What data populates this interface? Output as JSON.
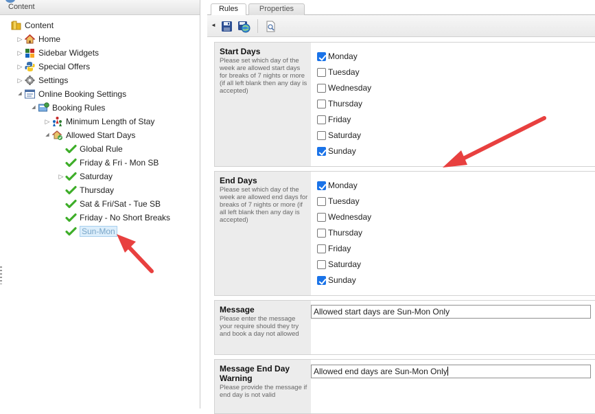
{
  "left_panel": {
    "header": "Content",
    "tree": [
      {
        "label": "Content",
        "icon": "folder-icon",
        "level": 0,
        "expander": "none"
      },
      {
        "label": "Home",
        "icon": "home-icon",
        "level": 1,
        "expander": "collapsed"
      },
      {
        "label": "Sidebar Widgets",
        "icon": "widgets-icon",
        "level": 1,
        "expander": "collapsed"
      },
      {
        "label": "Special Offers",
        "icon": "python-icon",
        "level": 1,
        "expander": "collapsed"
      },
      {
        "label": "Settings",
        "icon": "gear-icon",
        "level": 1,
        "expander": "collapsed"
      },
      {
        "label": "Online Booking Settings",
        "icon": "settings-form-icon",
        "level": 1,
        "expander": "expanded"
      },
      {
        "label": "Booking Rules",
        "icon": "rules-icon",
        "level": 2,
        "expander": "expanded"
      },
      {
        "label": "Minimum Length of Stay",
        "icon": "people-icon",
        "level": 3,
        "expander": "collapsed"
      },
      {
        "label": "Allowed Start Days",
        "icon": "house-check-icon",
        "level": 3,
        "expander": "expanded"
      },
      {
        "label": "Global Rule",
        "icon": "checkmark-icon",
        "level": 4,
        "expander": "none"
      },
      {
        "label": "Friday & Fri - Mon SB",
        "icon": "checkmark-icon",
        "level": 4,
        "expander": "none"
      },
      {
        "label": "Saturday",
        "icon": "checkmark-icon",
        "level": 4,
        "expander": "collapsed"
      },
      {
        "label": "Thursday",
        "icon": "checkmark-icon",
        "level": 4,
        "expander": "none"
      },
      {
        "label": "Sat & Fri/Sat - Tue SB",
        "icon": "checkmark-icon",
        "level": 4,
        "expander": "none"
      },
      {
        "label": "Friday - No Short Breaks",
        "icon": "checkmark-icon",
        "level": 4,
        "expander": "none"
      },
      {
        "label": "Sun-Mon",
        "icon": "checkmark-icon",
        "level": 4,
        "expander": "none",
        "selected": true
      }
    ]
  },
  "tabs": [
    {
      "label": "Rules",
      "active": true
    },
    {
      "label": "Properties",
      "active": false
    }
  ],
  "toolbar": {
    "icons": [
      "save-icon",
      "save-publish-icon",
      "preview-icon"
    ]
  },
  "sections": {
    "start_days": {
      "title": "Start Days",
      "description": "Please set which day of the week are allowed start days for breaks of 7 nights or more (if all left blank then any day is accepted)",
      "days": [
        {
          "label": "Monday",
          "checked": true
        },
        {
          "label": "Tuesday",
          "checked": false
        },
        {
          "label": "Wednesday",
          "checked": false
        },
        {
          "label": "Thursday",
          "checked": false
        },
        {
          "label": "Friday",
          "checked": false
        },
        {
          "label": "Saturday",
          "checked": false
        },
        {
          "label": "Sunday",
          "checked": true
        }
      ]
    },
    "end_days": {
      "title": "End Days",
      "description": "Please set which day of the week are allowed end days for breaks of 7 nights or more (if all left blank then any day is accepted)",
      "days": [
        {
          "label": "Monday",
          "checked": true
        },
        {
          "label": "Tuesday",
          "checked": false
        },
        {
          "label": "Wednesday",
          "checked": false
        },
        {
          "label": "Thursday",
          "checked": false
        },
        {
          "label": "Friday",
          "checked": false
        },
        {
          "label": "Saturday",
          "checked": false
        },
        {
          "label": "Sunday",
          "checked": true
        }
      ]
    },
    "message": {
      "title": "Message",
      "description": "Please enter the message your require should they try and book a day not allowed",
      "value": "Allowed start days are Sun-Mon Only"
    },
    "message_end_day": {
      "title": "Message End Day Warning",
      "description": "Please provide the message if end day is not valid",
      "value": "Allowed end days are Sun-Mon Only"
    }
  },
  "colors": {
    "checkbox_checked": "#1a73e8",
    "annotation_arrow": "#e8403f",
    "selected_node_bg": "#dceefb",
    "check_green": "#3fae2a"
  }
}
